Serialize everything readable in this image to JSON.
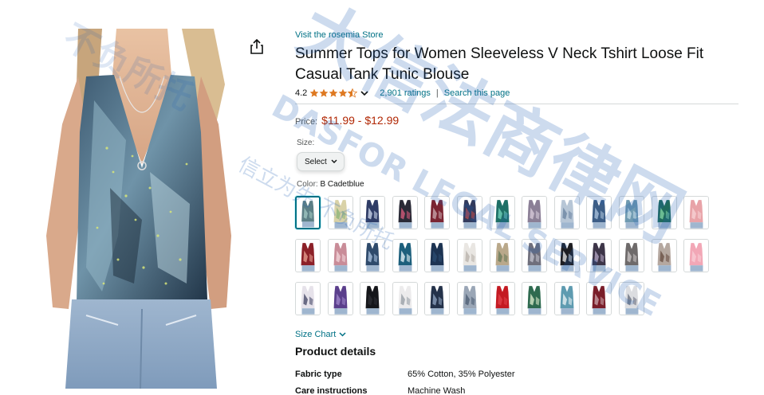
{
  "store_link": "Visit the rosemia Store",
  "title": "Summer Tops for Women Sleeveless V Neck Tshirt Loose Fit Casual Tank Tunic Blouse",
  "rating": {
    "value": "4.2",
    "stars": 4.2,
    "ratings_count": "2,901 ratings",
    "search_link": "Search this page",
    "separator": "|"
  },
  "price": {
    "label": "Price:",
    "range": "$11.99 - $12.99"
  },
  "size": {
    "label": "Size:",
    "selected": "Select"
  },
  "color": {
    "label": "Color:",
    "selected": "B Cadetblue"
  },
  "swatches": [
    {
      "color": "#5c7f86",
      "accent": "#9fc6c0",
      "selected": true
    },
    {
      "color": "#d9d2a8",
      "accent": "#8fb57a",
      "selected": false
    },
    {
      "color": "#2f3c66",
      "accent": "#c9d3e8",
      "selected": false
    },
    {
      "color": "#2a2a36",
      "accent": "#d35a7a",
      "selected": false
    },
    {
      "color": "#7a2532",
      "accent": "#c7a3a8",
      "selected": false
    },
    {
      "color": "#323a5c",
      "accent": "#b84a4a",
      "selected": false
    },
    {
      "color": "#1e6f66",
      "accent": "#6fcfb9",
      "selected": false
    },
    {
      "color": "#8b7f96",
      "accent": "#d6c9d8",
      "selected": false
    },
    {
      "color": "#b7c6d6",
      "accent": "#6d86a3",
      "selected": false
    },
    {
      "color": "#3c5d86",
      "accent": "#a6bfd9",
      "selected": false
    },
    {
      "color": "#6f9ab1",
      "accent": "#c2d9e6",
      "selected": false
    },
    {
      "color": "#1f6a5c",
      "accent": "#7dd0a0",
      "selected": false
    },
    {
      "color": "#e8a3a8",
      "accent": "#f6d1d3",
      "selected": false
    },
    {
      "color": "#8c2028",
      "accent": "#e39b8c",
      "selected": false
    },
    {
      "color": "#c98c98",
      "accent": "#f1d3d8",
      "selected": false
    },
    {
      "color": "#2e4a6b",
      "accent": "#a9c1de",
      "selected": false
    },
    {
      "color": "#1c5f7c",
      "accent": "#e2f0f5",
      "selected": false
    },
    {
      "color": "#1c3352",
      "accent": "#2b4b70",
      "selected": false
    },
    {
      "color": "#e9e6e2",
      "accent": "#b9b3ac",
      "selected": false
    },
    {
      "color": "#b9a88a",
      "accent": "#6a7b5a",
      "selected": false
    },
    {
      "color": "#6f6f7c",
      "accent": "#c0c0cc",
      "selected": false
    },
    {
      "color": "#1e1e22",
      "accent": "#e0e0e0",
      "selected": false
    },
    {
      "color": "#3d3548",
      "accent": "#b0a3c1",
      "selected": false
    },
    {
      "color": "#6e6a6a",
      "accent": "#c8c3c3",
      "selected": false
    },
    {
      "color": "#b5a8a0",
      "accent": "#6a5045",
      "selected": false
    },
    {
      "color": "#f2a7b6",
      "accent": "#f8cdd6",
      "selected": false
    },
    {
      "color": "#e6e2ea",
      "accent": "#4a4c6a",
      "selected": false
    },
    {
      "color": "#5b3f8c",
      "accent": "#9f86c9",
      "selected": false
    },
    {
      "color": "#15161a",
      "accent": "#2c2d33",
      "selected": false
    },
    {
      "color": "#ecebec",
      "accent": "#9aa0a8",
      "selected": false
    },
    {
      "color": "#24324a",
      "accent": "#8ca0bd",
      "selected": false
    },
    {
      "color": "#9aa6b6",
      "accent": "#4f5f75",
      "selected": false
    },
    {
      "color": "#c41a22",
      "accent": "#e04049",
      "selected": false
    },
    {
      "color": "#2e6a4f",
      "accent": "#d7e8c8",
      "selected": false
    },
    {
      "color": "#5e9bb0",
      "accent": "#e6f0f3",
      "selected": false
    },
    {
      "color": "#7a1e2a",
      "accent": "#c8a0a7",
      "selected": false
    },
    {
      "color": "#dcdde0",
      "accent": "#6c7280",
      "selected": false
    }
  ],
  "size_chart": "Size Chart",
  "product_details": {
    "title": "Product details",
    "rows": [
      {
        "key": "Fabric type",
        "value": "65% Cotton, 35% Polyester"
      },
      {
        "key": "Care instructions",
        "value": "Machine Wash"
      }
    ]
  },
  "icons": {
    "share": "share-icon",
    "star": "star-icon",
    "chevron": "chevron-down-icon"
  },
  "colors": {
    "link": "#007185",
    "price": "#b12704",
    "star": "#de7921",
    "watermark": "#1f5fb5"
  },
  "watermark": {
    "main_cn": "大信法商律网",
    "brand_en": "DASFOR LEGAL SERVICE",
    "sub_cn": "信立为先 不负所托",
    "sub2_cn": "不负所托"
  }
}
